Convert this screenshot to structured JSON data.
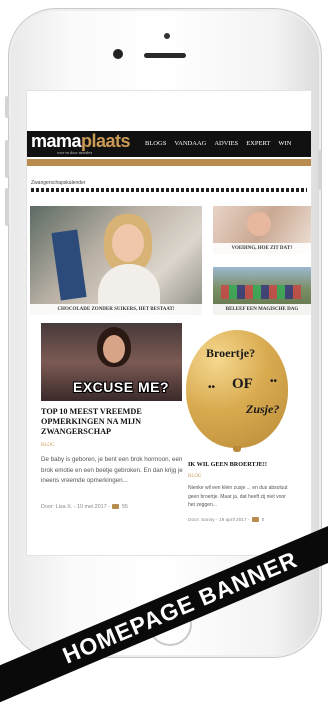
{
  "site": {
    "logo_main": "mama",
    "logo_accent": "plaats",
    "tagline": "voor en door moeders",
    "nav": [
      "BLOGS",
      "VANDAAG",
      "ADVIES",
      "EXPERT",
      "WIN"
    ]
  },
  "calendar": {
    "label": "Zwangerschapskalender"
  },
  "features": [
    {
      "caption": "CHOCOLADE ZONDER SUIKERS, HET BESTAAT!"
    },
    {
      "caption": "VOEDING, HOE ZIT DAT?"
    },
    {
      "caption": "BELEEF EEN MAGISCHE DAG"
    }
  ],
  "posts": [
    {
      "image_text": "EXCUSE ME?",
      "title": "TOP 10 MEEST VREEMDE OPMERKINGEN NA MIJN ZWANGERSCHAP",
      "category": "BLOG",
      "excerpt": "De baby is geboren, je bent een brok hormoon, een brok emotie en een beetje gebroken. En dan krijg je ineens vreemde opmerkingen...",
      "meta_prefix": "Door: ",
      "author": "Lisa X.",
      "date": "- 10 mei 2017 -",
      "comments": "55"
    },
    {
      "image_text_1": "Broertje?",
      "image_text_2": "OF",
      "image_text_3": "Zusje?",
      "title": "IK WIL GEEN BROERTJE!!",
      "category": "BLOG",
      "excerpt": "Nienke wil een klein zusje ... en dus absoluut geen broertje. Maar ja, dat heeft zij niet voor het zeggen...",
      "meta_prefix": "Door: ",
      "author": "Sanny",
      "date": "- 19 april 2017 -",
      "comments": "0"
    }
  ],
  "banner": {
    "text": "HOMEPAGE BANNER"
  },
  "colors": {
    "brand_gold": "#b88c4f",
    "header_bg": "#111111"
  }
}
